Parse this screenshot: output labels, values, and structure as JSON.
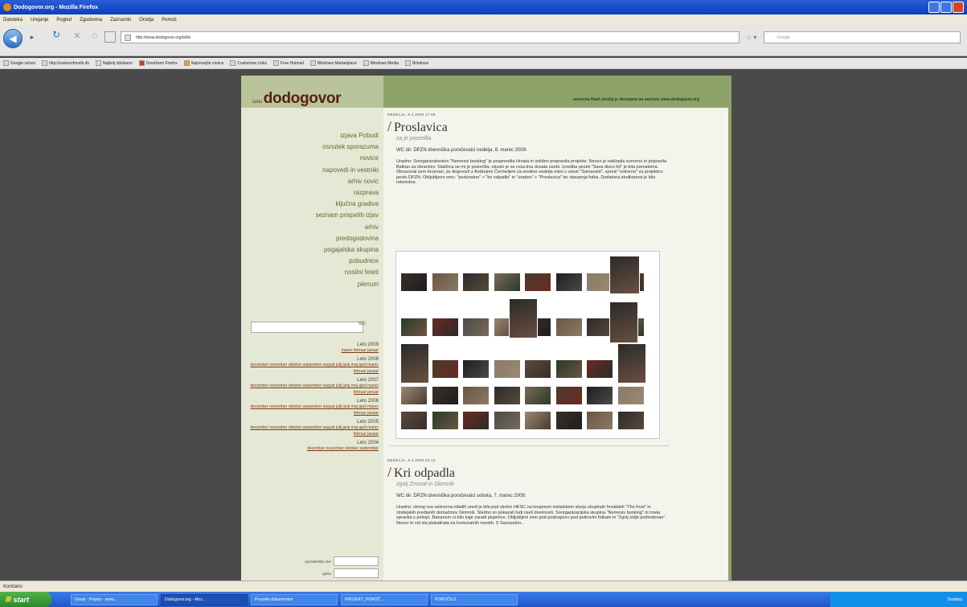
{
  "window": {
    "title": "Dodogovor.org - Mozilla Firefox"
  },
  "menu": [
    "Datoteka",
    "Urejanje",
    "Pogled",
    "Zgodovina",
    "Zaznamki",
    "Orodja",
    "Pomoč"
  ],
  "nav": {
    "url": "http://www.dodogovor.org/lahki",
    "search_placeholder": "Google"
  },
  "bookmarks": [
    "Google računi",
    "http://zaslonsfrmsfs.ds",
    "Najbolj obiskano",
    "Osveženo Firefox",
    "Najnovejše novice",
    "Customize Links",
    "Free Hotmail",
    "Windows Marketplace",
    "Windows Media",
    "Windows"
  ],
  "site": {
    "logo_small": "lahki",
    "logo_big": "dodogovor",
    "tagline": "osnovna flash verzija je dostopna na naslovu www.dodogovor.org",
    "nav": [
      "izjava Pobudi",
      "osnutek sporazuma",
      "novice",
      "napovedi in vestniki",
      "arhiv novic",
      "razprava",
      "ključna gradiva",
      "seznam prispelih izjav",
      "arhiv",
      "predogodovina",
      "pogajalska skupina",
      "pobudnice",
      "nosilni feteti",
      "plenum"
    ],
    "search_button": "išči",
    "archive": [
      {
        "year": "Leto 2009",
        "months": "marec februar januar"
      },
      {
        "year": "Leto 2008",
        "months": "december november oktober september avgust julij junij maj april marec februar januar"
      },
      {
        "year": "Leto 2007",
        "months": "december november oktober september avgust julij junij maj april marec februar januar"
      },
      {
        "year": "Leto 2006",
        "months": "december november oktober september avgust julij junij maj april marec februar januar"
      },
      {
        "year": "Leto 2005",
        "months": "december november oktober september avgust julij junij maj april marec februar januar"
      },
      {
        "year": "Leto 2004",
        "months": "december november oktober september"
      }
    ],
    "login_user_label": "uporabniško ime",
    "login_pass_label": "geslo"
  },
  "posts": [
    {
      "date": "NEDELJA, 8.3.2009 17:09",
      "title": "Proslavica",
      "subtitle": "za je poorellla",
      "meta": "WC dir. DPZN dnevniška poročevalci nedelja, 8. marec 2009:",
      "body": "Uradno: Soorganizatorstvo \"Nemesis booking\" je posprentila Hrvata in solidno prepravila projekte. Nevez je naklopila surrorno in pripravila Balkan za obrančev. Slaščica se mi je posrečila, okuslo je se rosa dva dusata osebi. Izvedba pesmi \"Sava disco hit\" je bila prenatolna. Obrazonal sem brosnan, ze dogovoril z Andrejem Čermeljem za sredino sedetja mizo v vanst \"Samarskit\", sprosl \"votrorno\" za projektno pesto DPZN. Obljubljeno smo: \"podunalno\" + \"kri odpadla\" in \"uradno\" + \"Proslavica\" ter danasnja fotka. Dodatona studkanost je bila retoredna."
    },
    {
      "date": "NEDELJA, 8.3.2009 03:13",
      "title": "Kri odpadla",
      "subtitle": "zgolj Zmrzal in Slomnik",
      "meta": "WC dir. DPZN dnevniška poročevalci sobota, 7. marec 2009:",
      "body": "Uradno: skoraj vsa vešnorna niladih sredi je bila pod streho HKSC na koupnem metalskem slavju skupinah hrvatskih \"The frost\" in zlodejskih predianih domačinov Slomnik. Sledno so pokazali tudi riseli dverinosti. Soorganizacijska skupina \"Nemesis booking\" ni imela opravka s pokojo. Bananom ni bilo kaje zaradi plupinice. Obljubljeni smo pod podnapcev pod petkovim fotkam in \"Zgolj Izdje podrodovan\". Nevez in vid sta plakatirata na komunalnih mestih. S Sanuselon..."
    }
  ],
  "status_bar": "Končano",
  "taskbar": {
    "start": "start",
    "items": [
      "Gmail - Prejeto - www...",
      "Dodogovor.org - Moz...",
      "Povzetki dokumentov",
      "PROJEKT_POROČ...",
      "POROČILO"
    ],
    "tray": "Desktop"
  }
}
